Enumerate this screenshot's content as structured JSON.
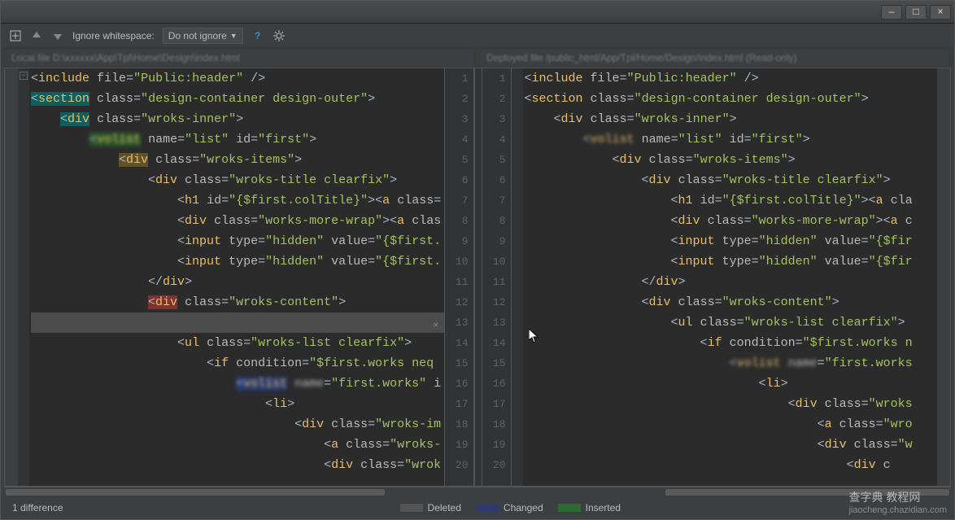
{
  "titlebar": {
    "min": "—",
    "max": "□",
    "close": "×"
  },
  "toolbar": {
    "ignore_label": "Ignore whitespace:",
    "dropdown_value": "Do not ignore",
    "help": "?"
  },
  "pathbar": {
    "left": "Local file  D:\\xxxxxx\\App\\Tpl\\Home\\Design\\index.html",
    "right": "Deployed file  /public_html/App/Tpl/Home/Design/index.html (Read-only)"
  },
  "gutter_left": [
    "1",
    "2",
    "3",
    "4",
    "5",
    "6",
    "7",
    "8",
    "9",
    "10",
    "11",
    "12",
    "13",
    "14",
    "15",
    "16",
    "17",
    "18",
    "19",
    "20"
  ],
  "gutter_right": [
    "1",
    "2",
    "3",
    "4",
    "5",
    "6",
    "7",
    "8",
    "9",
    "10",
    "11",
    "12",
    "13",
    "14",
    "15",
    "16",
    "17",
    "18",
    "19",
    "20"
  ],
  "code_left": [
    {
      "indent": 0,
      "html": "<span class='t-punc'>&lt;</span><span class='t-tag'>include</span> <span class='t-attr'>file</span><span class='t-punc'>=</span><span class='t-value'>\"Public:header\"</span> <span class='t-punc'>/&gt;</span>"
    },
    {
      "indent": 0,
      "html": "<span class='hl-teal'><span class='t-punc'>&lt;</span><span class='t-tag'>section</span></span> <span class='t-attr'>class</span><span class='t-punc'>=</span><span class='t-value'>\"design-container design-outer\"</span><span class='t-punc'>&gt;</span>"
    },
    {
      "indent": 1,
      "html": "<span class='hl-teal'><span class='t-punc'>&lt;</span><span class='t-tag'>div</span></span> <span class='t-attr'>class</span><span class='t-punc'>=</span><span class='t-value'>\"wroks-inner\"</span><span class='t-punc'>&gt;</span>"
    },
    {
      "indent": 2,
      "html": "<span class='hl-green blur'><span class='t-punc'>&lt;</span><span class='t-tag'>volist</span></span> <span class='t-attr'>name</span><span class='t-punc'>=</span><span class='t-value'>\"list\"</span> <span class='t-attr'>id</span><span class='t-punc'>=</span><span class='t-value'>\"first\"</span><span class='t-punc'>&gt;</span>"
    },
    {
      "indent": 3,
      "html": "<span class='hl-yellow'><span class='t-punc'>&lt;</span><span class='t-tag'>div</span></span> <span class='t-attr'>class</span><span class='t-punc'>=</span><span class='t-value'>\"wroks-items\"</span><span class='t-punc'>&gt;</span>"
    },
    {
      "indent": 4,
      "html": "<span class='t-punc'>&lt;</span><span class='t-tag'>div</span> <span class='t-attr'>class</span><span class='t-punc'>=</span><span class='t-value'>\"wroks-title clearfix\"</span><span class='t-punc'>&gt;</span>"
    },
    {
      "indent": 5,
      "html": "<span class='t-punc'>&lt;</span><span class='t-tag'>h1</span> <span class='t-attr'>id</span><span class='t-punc'>=</span><span class='t-value'>\"{$first.colTitle}\"</span><span class='t-punc'>&gt;&lt;</span><span class='t-tag'>a</span> <span class='t-attr'>class</span><span class='t-punc'>=</span>"
    },
    {
      "indent": 5,
      "html": "<span class='t-punc'>&lt;</span><span class='t-tag'>div</span> <span class='t-attr'>class</span><span class='t-punc'>=</span><span class='t-value'>\"works-more-wrap\"</span><span class='t-punc'>&gt;&lt;</span><span class='t-tag'>a</span> <span class='t-attr'>clas</span>"
    },
    {
      "indent": 5,
      "html": "<span class='t-punc'>&lt;</span><span class='t-tag'>input</span> <span class='t-attr'>type</span><span class='t-punc'>=</span><span class='t-value'>\"hidden\"</span> <span class='t-attr'>value</span><span class='t-punc'>=</span><span class='t-value'>\"{$first.</span>"
    },
    {
      "indent": 5,
      "html": "<span class='t-punc'>&lt;</span><span class='t-tag'>input</span> <span class='t-attr'>type</span><span class='t-punc'>=</span><span class='t-value'>\"hidden\"</span> <span class='t-attr'>value</span><span class='t-punc'>=</span><span class='t-value'>\"{$first.</span>"
    },
    {
      "indent": 4,
      "html": "<span class='t-punc'>&lt;/</span><span class='t-tag'>div</span><span class='t-punc'>&gt;</span>"
    },
    {
      "indent": 4,
      "html": "<span class='hl-red'><span class='t-punc'>&lt;</span><span class='t-tag'>div</span></span> <span class='t-attr'>class</span><span class='t-punc'>=</span><span class='t-value'>\"wroks-content\"</span><span class='t-punc'>&gt;</span>"
    },
    {
      "indent": 0,
      "html": "",
      "selected": true,
      "closer": "×"
    },
    {
      "indent": 5,
      "html": "<span class='t-punc'>&lt;</span><span class='t-tag'>ul</span> <span class='t-attr'>class</span><span class='t-punc'>=</span><span class='t-value'>\"wroks-list clearfix\"</span><span class='t-punc'>&gt;</span>"
    },
    {
      "indent": 6,
      "html": "<span class='t-punc'>&lt;</span><span class='t-tag'>if</span> <span class='t-attr'>condition</span><span class='t-punc'>=</span><span class='t-value'>\"$first.works neq</span>"
    },
    {
      "indent": 7,
      "html": "<span class='hl-blue blur'><span class='t-punc'>&lt;</span><span class='t-tag'>volist</span></span> <span class='t-attr blur'>name</span><span class='t-punc'>=</span><span class='t-value'>\"first.works\"</span> <span class='t-attr'>i</span>"
    },
    {
      "indent": 8,
      "html": "<span class='t-punc'>&lt;</span><span class='t-tag'>li</span><span class='t-punc'>&gt;</span>"
    },
    {
      "indent": 9,
      "html": "<span class='t-punc'>&lt;</span><span class='t-tag'>div</span> <span class='t-attr'>class</span><span class='t-punc'>=</span><span class='t-value'>\"wroks-im</span>"
    },
    {
      "indent": 10,
      "html": "<span class='t-punc'>&lt;</span><span class='t-tag'>a</span> <span class='t-attr'>class</span><span class='t-punc'>=</span><span class='t-value'>\"wroks-</span>"
    },
    {
      "indent": 10,
      "html": "<span class='t-punc'>&lt;</span><span class='t-tag'>div</span> <span class='t-attr'>class</span><span class='t-punc'>=</span><span class='t-value'>\"wrok</span>"
    }
  ],
  "code_right": [
    {
      "indent": 0,
      "html": "<span class='t-punc'>&lt;</span><span class='t-tag'>include</span> <span class='t-attr'>file</span><span class='t-punc'>=</span><span class='t-value'>\"Public:header\"</span> <span class='t-punc'>/&gt;</span>"
    },
    {
      "indent": 0,
      "html": "<span class='t-punc'>&lt;</span><span class='t-tag'>section</span> <span class='t-attr'>class</span><span class='t-punc'>=</span><span class='t-value'>\"design-container design-outer\"</span><span class='t-punc'>&gt;</span>"
    },
    {
      "indent": 1,
      "html": "<span class='t-punc'>&lt;</span><span class='t-tag'>div</span> <span class='t-attr'>class</span><span class='t-punc'>=</span><span class='t-value'>\"wroks-inner\"</span><span class='t-punc'>&gt;</span>"
    },
    {
      "indent": 2,
      "html": "<span class='blur'><span class='t-punc'>&lt;</span><span class='t-tag'>volist</span></span> <span class='t-attr'>name</span><span class='t-punc'>=</span><span class='t-value'>\"list\"</span> <span class='t-attr'>id</span><span class='t-punc'>=</span><span class='t-value'>\"first\"</span><span class='t-punc'>&gt;</span>"
    },
    {
      "indent": 3,
      "html": "<span class='t-punc'>&lt;</span><span class='t-tag'>div</span> <span class='t-attr'>class</span><span class='t-punc'>=</span><span class='t-value'>\"wroks-items\"</span><span class='t-punc'>&gt;</span>"
    },
    {
      "indent": 4,
      "html": "<span class='t-punc'>&lt;</span><span class='t-tag'>div</span> <span class='t-attr'>class</span><span class='t-punc'>=</span><span class='t-value'>\"wroks-title clearfix\"</span><span class='t-punc'>&gt;</span>"
    },
    {
      "indent": 5,
      "html": "<span class='t-punc'>&lt;</span><span class='t-tag'>h1</span> <span class='t-attr'>id</span><span class='t-punc'>=</span><span class='t-value'>\"{$first.colTitle}\"</span><span class='t-punc'>&gt;&lt;</span><span class='t-tag'>a</span> <span class='t-attr'>cla</span>"
    },
    {
      "indent": 5,
      "html": "<span class='t-punc'>&lt;</span><span class='t-tag'>div</span> <span class='t-attr'>class</span><span class='t-punc'>=</span><span class='t-value'>\"works-more-wrap\"</span><span class='t-punc'>&gt;&lt;</span><span class='t-tag'>a</span> <span class='t-attr'>c</span>"
    },
    {
      "indent": 5,
      "html": "<span class='t-punc'>&lt;</span><span class='t-tag'>input</span> <span class='t-attr'>type</span><span class='t-punc'>=</span><span class='t-value'>\"hidden\"</span> <span class='t-attr'>value</span><span class='t-punc'>=</span><span class='t-value'>\"{$fir</span>"
    },
    {
      "indent": 5,
      "html": "<span class='t-punc'>&lt;</span><span class='t-tag'>input</span> <span class='t-attr'>type</span><span class='t-punc'>=</span><span class='t-value'>\"hidden\"</span> <span class='t-attr'>value</span><span class='t-punc'>=</span><span class='t-value'>\"{$fir</span>"
    },
    {
      "indent": 4,
      "html": "<span class='t-punc'>&lt;/</span><span class='t-tag'>div</span><span class='t-punc'>&gt;</span>"
    },
    {
      "indent": 4,
      "html": "<span class='t-punc'>&lt;</span><span class='t-tag'>div</span> <span class='t-attr'>class</span><span class='t-punc'>=</span><span class='t-value'>\"wroks-content\"</span><span class='t-punc'>&gt;</span>"
    },
    {
      "indent": 5,
      "html": "<span class='t-punc'>&lt;</span><span class='t-tag'>ul</span> <span class='t-attr'>class</span><span class='t-punc'>=</span><span class='t-value'>\"wroks-list clearfix\"</span><span class='t-punc'>&gt;</span>"
    },
    {
      "indent": 6,
      "html": "<span class='t-punc'>&lt;</span><span class='t-tag'>if</span> <span class='t-attr'>condition</span><span class='t-punc'>=</span><span class='t-value'>\"$first.works n</span>"
    },
    {
      "indent": 7,
      "html": "<span class='blur'><span class='t-punc'>&lt;</span><span class='t-tag'>volist</span></span> <span class='t-attr blur'>name</span><span class='t-punc'>=</span><span class='t-value'>\"first.works</span>"
    },
    {
      "indent": 8,
      "html": "<span class='t-punc'>&lt;</span><span class='t-tag'>li</span><span class='t-punc'>&gt;</span>"
    },
    {
      "indent": 9,
      "html": "<span class='t-punc'>&lt;</span><span class='t-tag'>div</span> <span class='t-attr'>class</span><span class='t-punc'>=</span><span class='t-value'>\"wroks</span>"
    },
    {
      "indent": 10,
      "html": "<span class='t-punc'>&lt;</span><span class='t-tag'>a</span> <span class='t-attr'>class</span><span class='t-punc'>=</span><span class='t-value'>\"wro</span>"
    },
    {
      "indent": 10,
      "html": "<span class='t-punc'>&lt;</span><span class='t-tag'>div</span> <span class='t-attr'>class</span><span class='t-punc'>=</span><span class='t-value'>\"w</span>"
    },
    {
      "indent": 11,
      "html": "<span class='t-punc'>&lt;</span><span class='t-tag'>div</span> <span class='t-attr'>c</span>"
    }
  ],
  "status": {
    "diff_count": "1 difference",
    "deleted": "Deleted",
    "changed": "Changed",
    "inserted": "Inserted"
  },
  "watermark": {
    "main": "查字典 教程网",
    "url": "jiaocheng.chazidian.com"
  }
}
